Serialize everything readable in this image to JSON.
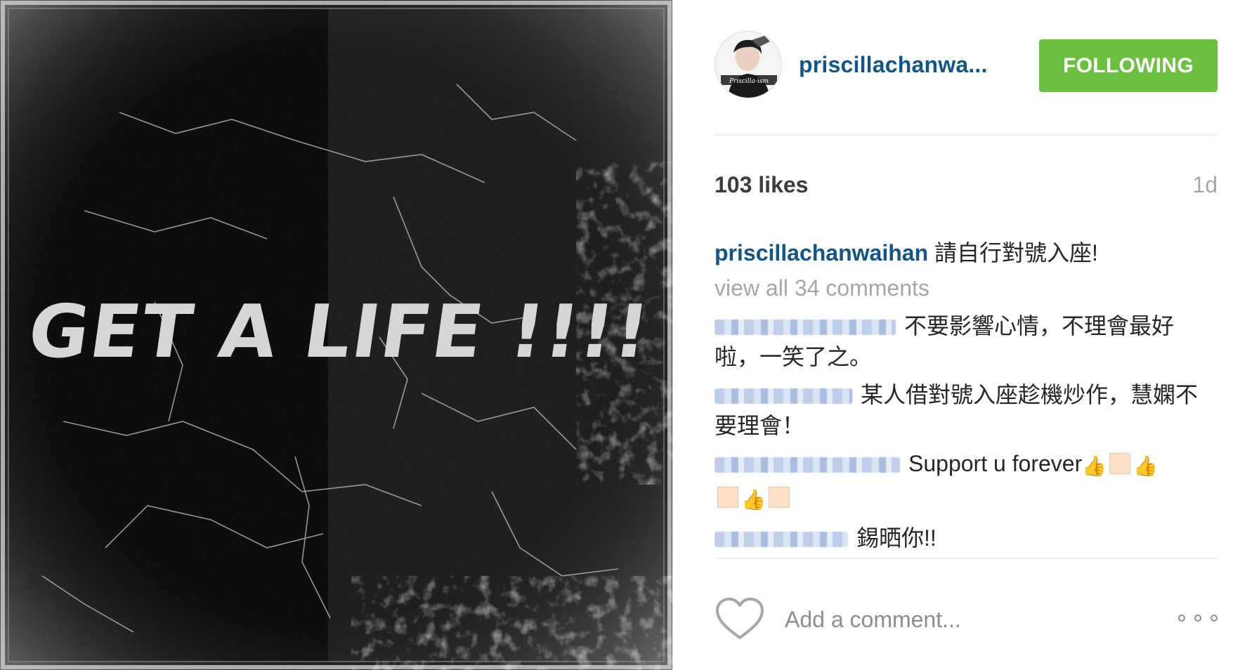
{
  "photo": {
    "overlay_text": "GET A LIFE !!!!"
  },
  "header": {
    "avatar_text": "Priscilla-ism",
    "username": "priscillachanwa...",
    "follow_label": "FOLLOWING"
  },
  "post": {
    "likes": "103 likes",
    "time": "1d",
    "caption_author": "priscillachanwaihan",
    "caption_text": "請自行對號入座!",
    "view_all": "view all 34 comments"
  },
  "comments": [
    {
      "author_blurred": true,
      "text": "不要影響心情，不理會最好啦，一笑了之。"
    },
    {
      "author_blurred": true,
      "text": "某人借對號入座趁機炒作，慧嫻不要理會！"
    },
    {
      "author_blurred": true,
      "text": "Support u forever"
    },
    {
      "author_blurred": true,
      "text": "錫晒你!!"
    }
  ],
  "footer": {
    "comment_placeholder": "Add a comment...",
    "heart_icon": "heart-outline-icon",
    "more_icon": "more-options-icon"
  },
  "colors": {
    "link_blue": "#125688",
    "follow_green": "#6cc03f",
    "muted_gray": "#a5a7aa"
  }
}
